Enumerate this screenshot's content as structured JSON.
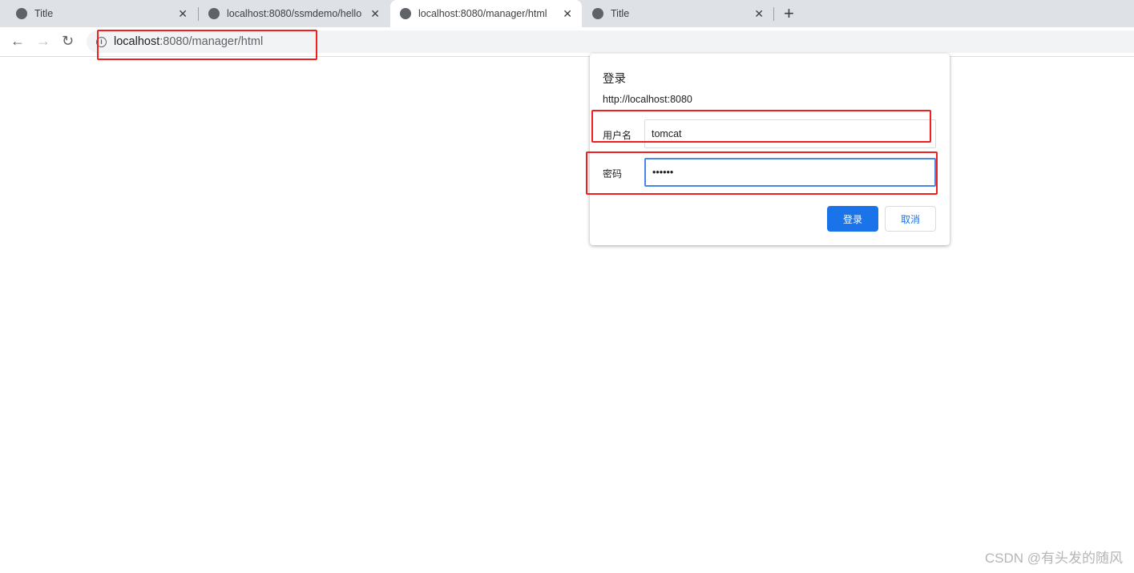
{
  "tabs": [
    {
      "title": "Title",
      "active": false
    },
    {
      "title": "localhost:8080/ssmdemo/hello",
      "active": false
    },
    {
      "title": "localhost:8080/manager/html",
      "active": true
    },
    {
      "title": "Title",
      "active": false
    }
  ],
  "address": {
    "host": "localhost",
    "path": ":8080/manager/html"
  },
  "dialog": {
    "title": "登录",
    "origin": "http://localhost:8080",
    "username_label": "用户名",
    "username_value": "tomcat",
    "password_label": "密码",
    "password_value": "••••••",
    "login_button": "登录",
    "cancel_button": "取消"
  },
  "watermark": "CSDN @有头发的随风",
  "colors": {
    "accent": "#1a73e8",
    "annotation": "#f02020"
  }
}
